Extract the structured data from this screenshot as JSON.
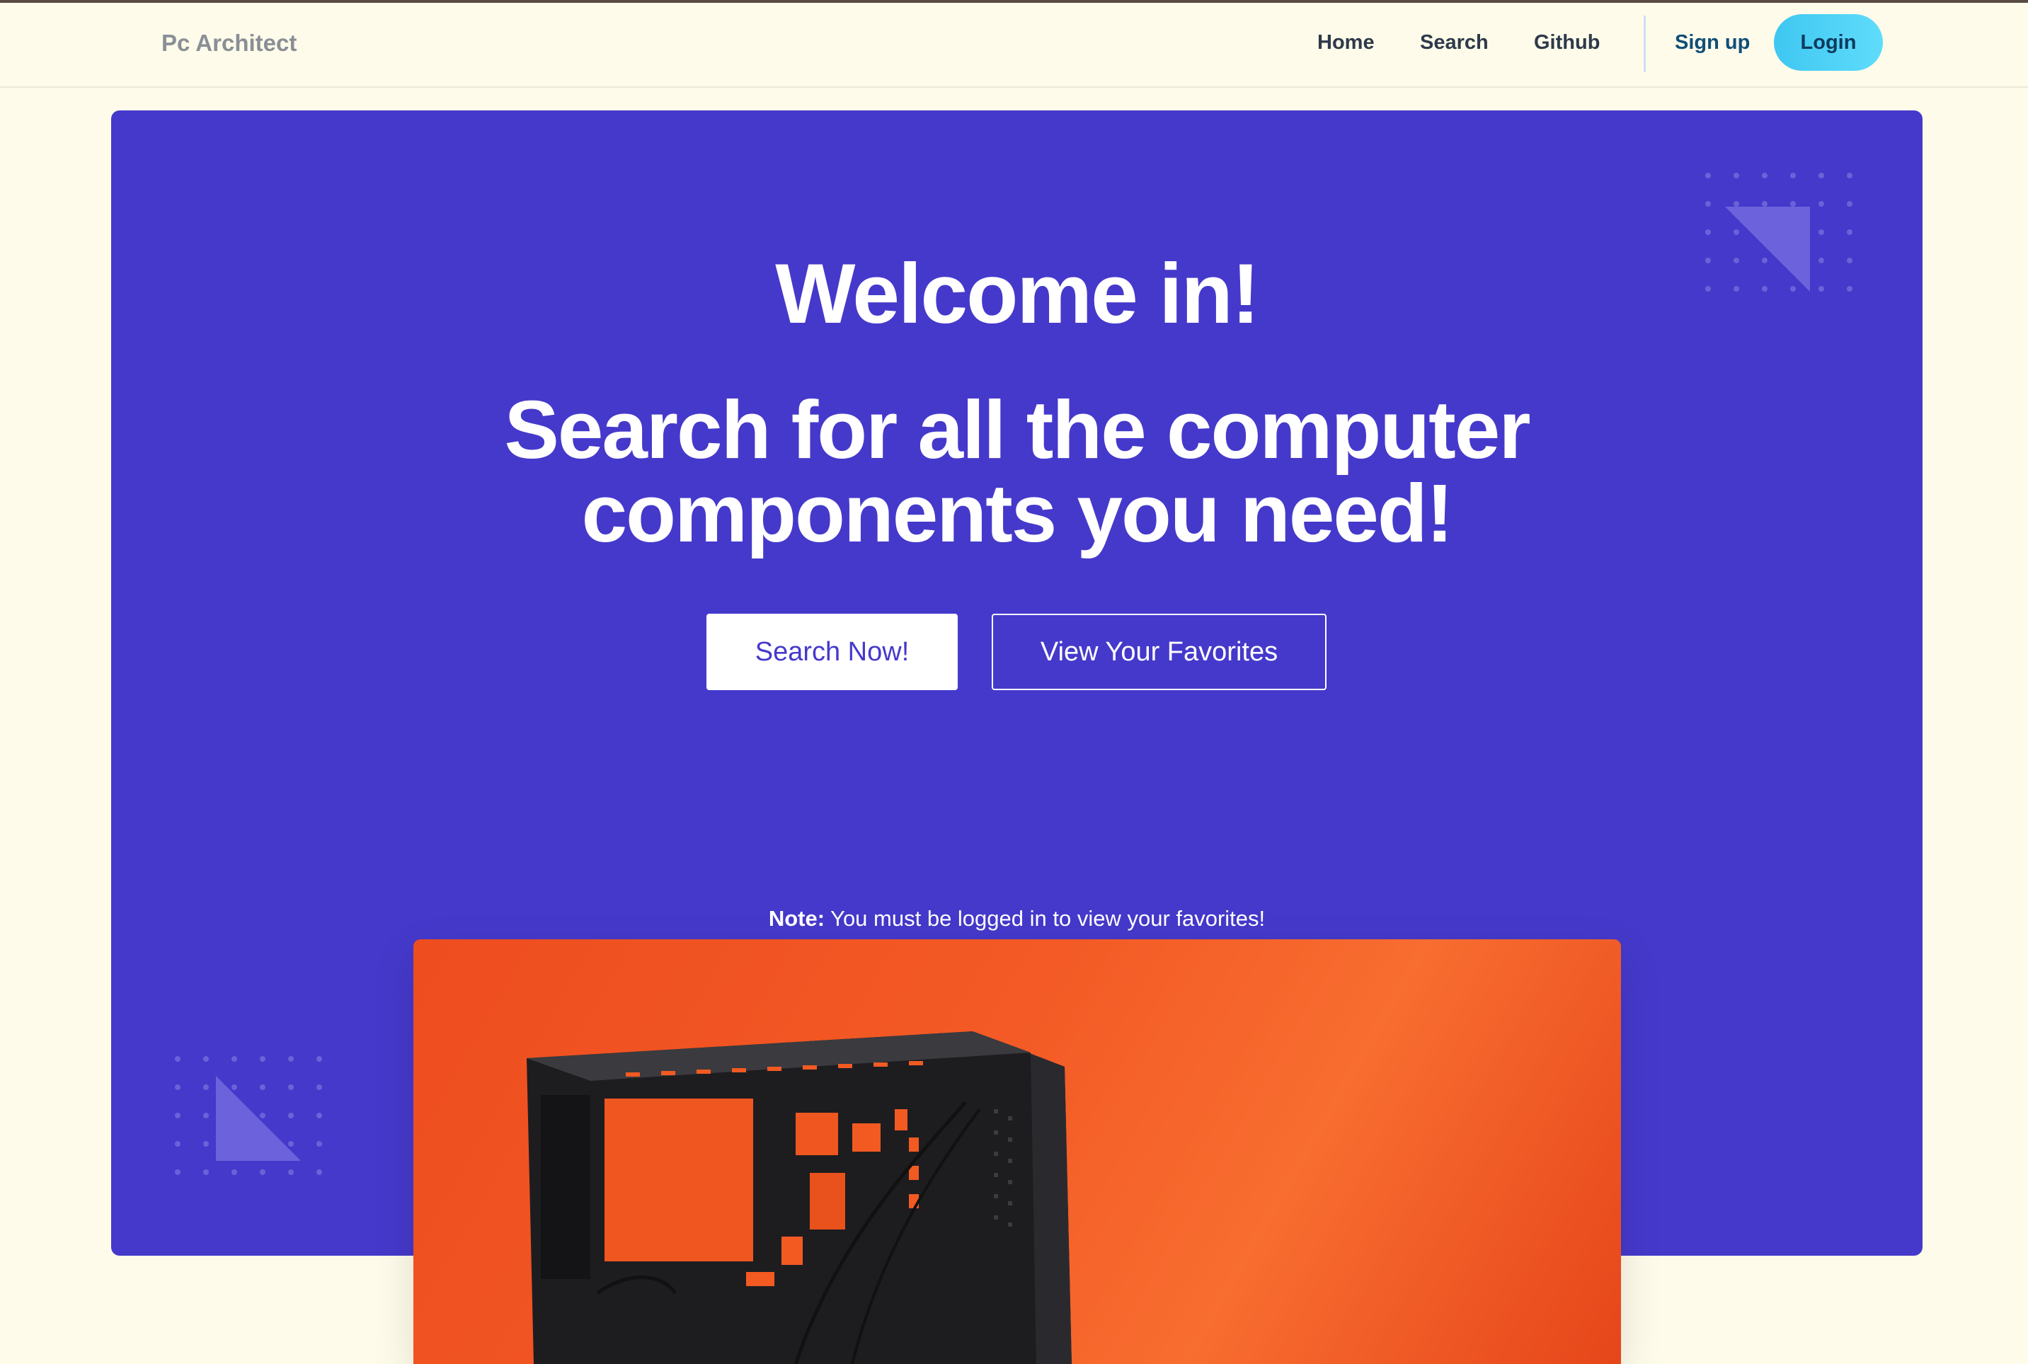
{
  "navbar": {
    "brand": "Pc Architect",
    "links": [
      {
        "label": "Home"
      },
      {
        "label": "Search"
      },
      {
        "label": "Github"
      }
    ],
    "signup_label": "Sign up",
    "login_label": "Login"
  },
  "hero": {
    "title": "Welcome in!",
    "subtitle": "Search for all the computer components you need!",
    "search_button": "Search Now!",
    "favorites_button": "View Your Favorites",
    "note_label": "Note:",
    "note_text": " You must be logged in to view your favorites!"
  },
  "colors": {
    "page_background": "#fefbea",
    "hero_background": "#4539cb",
    "login_button": "#3fc7f1",
    "image_background": "#f35a25"
  },
  "icons": {
    "decoration": "dot-grid-triangle-icon",
    "image": "pc-case-image"
  }
}
